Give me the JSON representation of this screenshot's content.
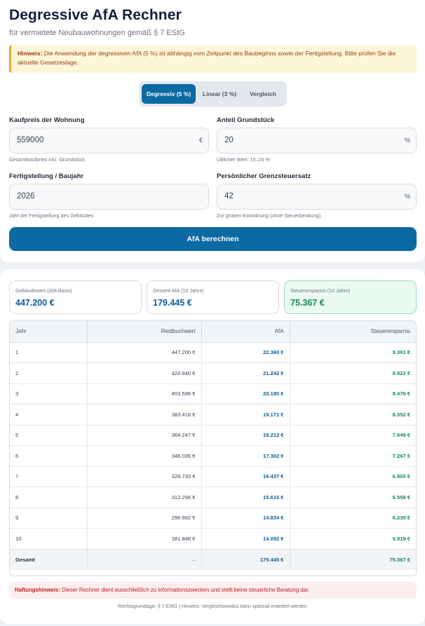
{
  "header": {
    "title": "Degressive AfA Rechner",
    "subtitle": "für vermietete Neubauwohnungen gemäß § 7 EStG"
  },
  "hint": {
    "prefix": "Hinweis:",
    "text": " Die Anwendung der degressiven AfA (5 %) ist abhängig vom Zeitpunkt des Baubeginns sowie der Fertigstellung. Bitte prüfen Sie die aktuelle Gesetzeslage."
  },
  "modes": {
    "degressive": "Degressiv (5 %)",
    "linear": "Linear (3 %)",
    "compare": "Vergleich",
    "active": "degressive"
  },
  "form": {
    "price": {
      "label": "Kaufpreis der Wohnung",
      "value": "559000",
      "unit": "€",
      "helper": "Gesamtkaufpreis inkl. Grundstück"
    },
    "land": {
      "label": "Anteil Grundstück",
      "value": "20",
      "unit": "%",
      "helper": "Üblicher Wert: 15–25 %"
    },
    "year": {
      "label": "Fertigstellung / Baujahr",
      "value": "2026",
      "helper": "Jahr der Fertigstellung des Gebäudes"
    },
    "tax": {
      "label": "Persönlicher Grenzsteuersatz",
      "value": "42",
      "unit": "%",
      "helper": "Zur groben Einordnung (ohne Steuerberatung)"
    },
    "submit": "AfA berechnen"
  },
  "summary": {
    "building": {
      "label": "Gebäudewert (AfA Basis)",
      "value": "447.200 €"
    },
    "afa": {
      "label": "Gesamt AfA (10 Jahre)",
      "value": "179.445 €"
    },
    "savings": {
      "label": "Steuerersparnis (10 Jahre)",
      "value": "75.367 €"
    }
  },
  "table": {
    "headers": {
      "year": "Jahr",
      "rest": "Restbuchwert",
      "afa": "AfA",
      "savings": "Steuerersparnis"
    },
    "rows": [
      {
        "year": "1",
        "rest": "447.200 €",
        "afa": "22.360 €",
        "savings": "9.391 €"
      },
      {
        "year": "2",
        "rest": "424.840 €",
        "afa": "21.242 €",
        "savings": "8.922 €"
      },
      {
        "year": "3",
        "rest": "403.598 €",
        "afa": "20.180 €",
        "savings": "8.476 €"
      },
      {
        "year": "4",
        "rest": "383.418 €",
        "afa": "19.171 €",
        "savings": "8.052 €"
      },
      {
        "year": "5",
        "rest": "364.247 €",
        "afa": "18.212 €",
        "savings": "7.649 €"
      },
      {
        "year": "6",
        "rest": "346.035 €",
        "afa": "17.302 €",
        "savings": "7.267 €"
      },
      {
        "year": "7",
        "rest": "328.733 €",
        "afa": "16.437 €",
        "savings": "6.903 €"
      },
      {
        "year": "8",
        "rest": "312.296 €",
        "afa": "15.615 €",
        "savings": "6.558 €"
      },
      {
        "year": "9",
        "rest": "296.682 €",
        "afa": "14.834 €",
        "savings": "6.230 €"
      },
      {
        "year": "10",
        "rest": "281.848 €",
        "afa": "14.092 €",
        "savings": "5.919 €"
      }
    ],
    "total": {
      "year": "Gesamt",
      "rest": "–",
      "afa": "179.445 €",
      "savings": "75.367 €"
    }
  },
  "disclaimer": {
    "prefix": "Haftungshinweis:",
    "text": " Dieser Rechner dient ausschließlich zu Informationszwecken und stellt keine steuerliche Beratung dar."
  },
  "footer": "Rechtsgrundlage: § 7 EStG | Hinweis: Vergleichsmodus kann optional erweitert werden"
}
